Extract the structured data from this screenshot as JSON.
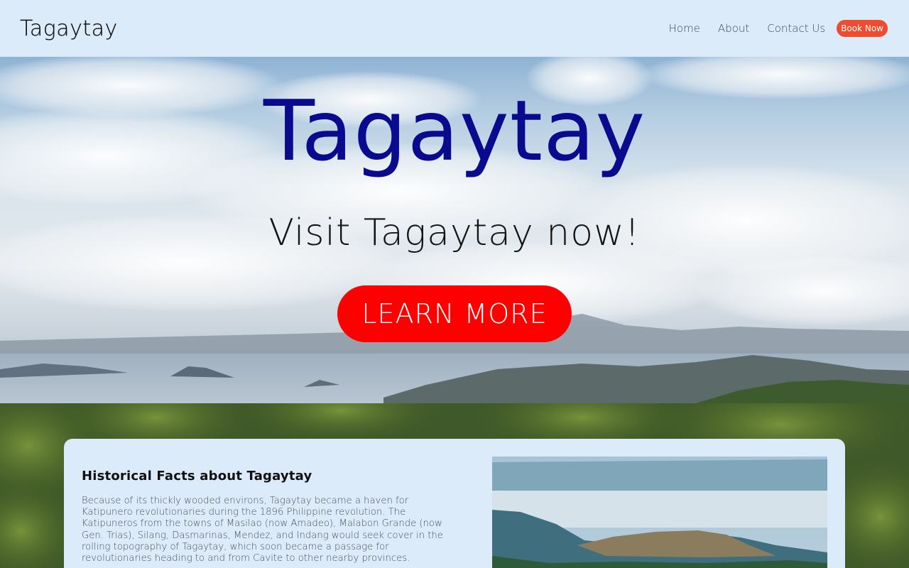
{
  "navbar": {
    "brand": "Tagaytay",
    "links": [
      "Home",
      "About",
      "Contact Us"
    ],
    "book_label": "Book Now",
    "book_color": "#ef4b2e",
    "background": "#dcebfa"
  },
  "hero": {
    "title": "Tagaytay",
    "subtitle": "Visit Tagaytay now!",
    "cta_label": "LEARN MORE",
    "title_color": "#0a0a8f",
    "cta_color": "#ff0000",
    "background_image": "sky-over-taal-lake-photo"
  },
  "facts": {
    "heading": "Historical Facts about Tagaytay",
    "body": "Because of its thickly wooded environs, Tagaytay became a haven for Katipunero revolutionaries during the 1896 Philippine revolution. The Katipuneros from the towns of Masilao (now Amadeo), Malabon Grande (now Gen. Trias), Silang, Dasmarinas, Mendez, and Indang would seek cover in the rolling topography of Tagaytay, which soon became a passage for revolutionaries heading to and from Cavite to other nearby provinces.",
    "image": "taal-volcano-island-photo"
  }
}
